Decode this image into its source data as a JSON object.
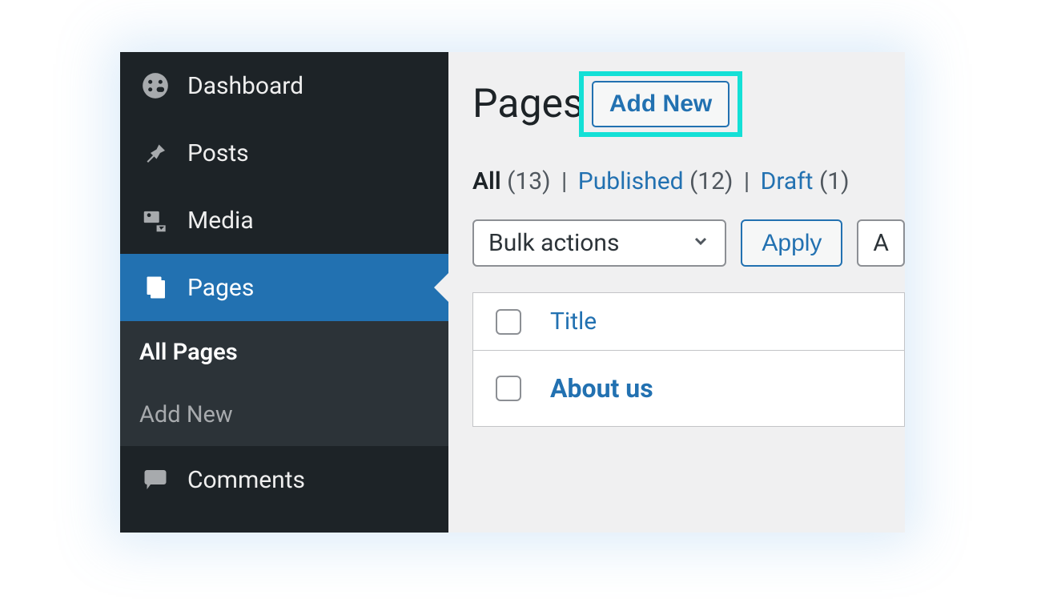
{
  "sidebar": {
    "items": [
      {
        "label": "Dashboard",
        "name": "dashboard"
      },
      {
        "label": "Posts",
        "name": "posts"
      },
      {
        "label": "Media",
        "name": "media"
      },
      {
        "label": "Pages",
        "name": "pages",
        "active": true
      },
      {
        "label": "Comments",
        "name": "comments"
      }
    ],
    "submenu": [
      {
        "label": "All Pages",
        "current": true
      },
      {
        "label": "Add New",
        "current": false
      }
    ]
  },
  "main": {
    "title": "Pages",
    "add_new_label": "Add New",
    "filters": {
      "all_label": "All",
      "all_count": "(13)",
      "published_label": "Published",
      "published_count": "(12)",
      "draft_label": "Draft",
      "draft_count": "(1)"
    },
    "bulk_actions_label": "Bulk actions",
    "apply_label": "Apply",
    "date_filter_partial": "A",
    "table": {
      "title_header": "Title",
      "rows": [
        {
          "title": "About us"
        }
      ]
    }
  }
}
